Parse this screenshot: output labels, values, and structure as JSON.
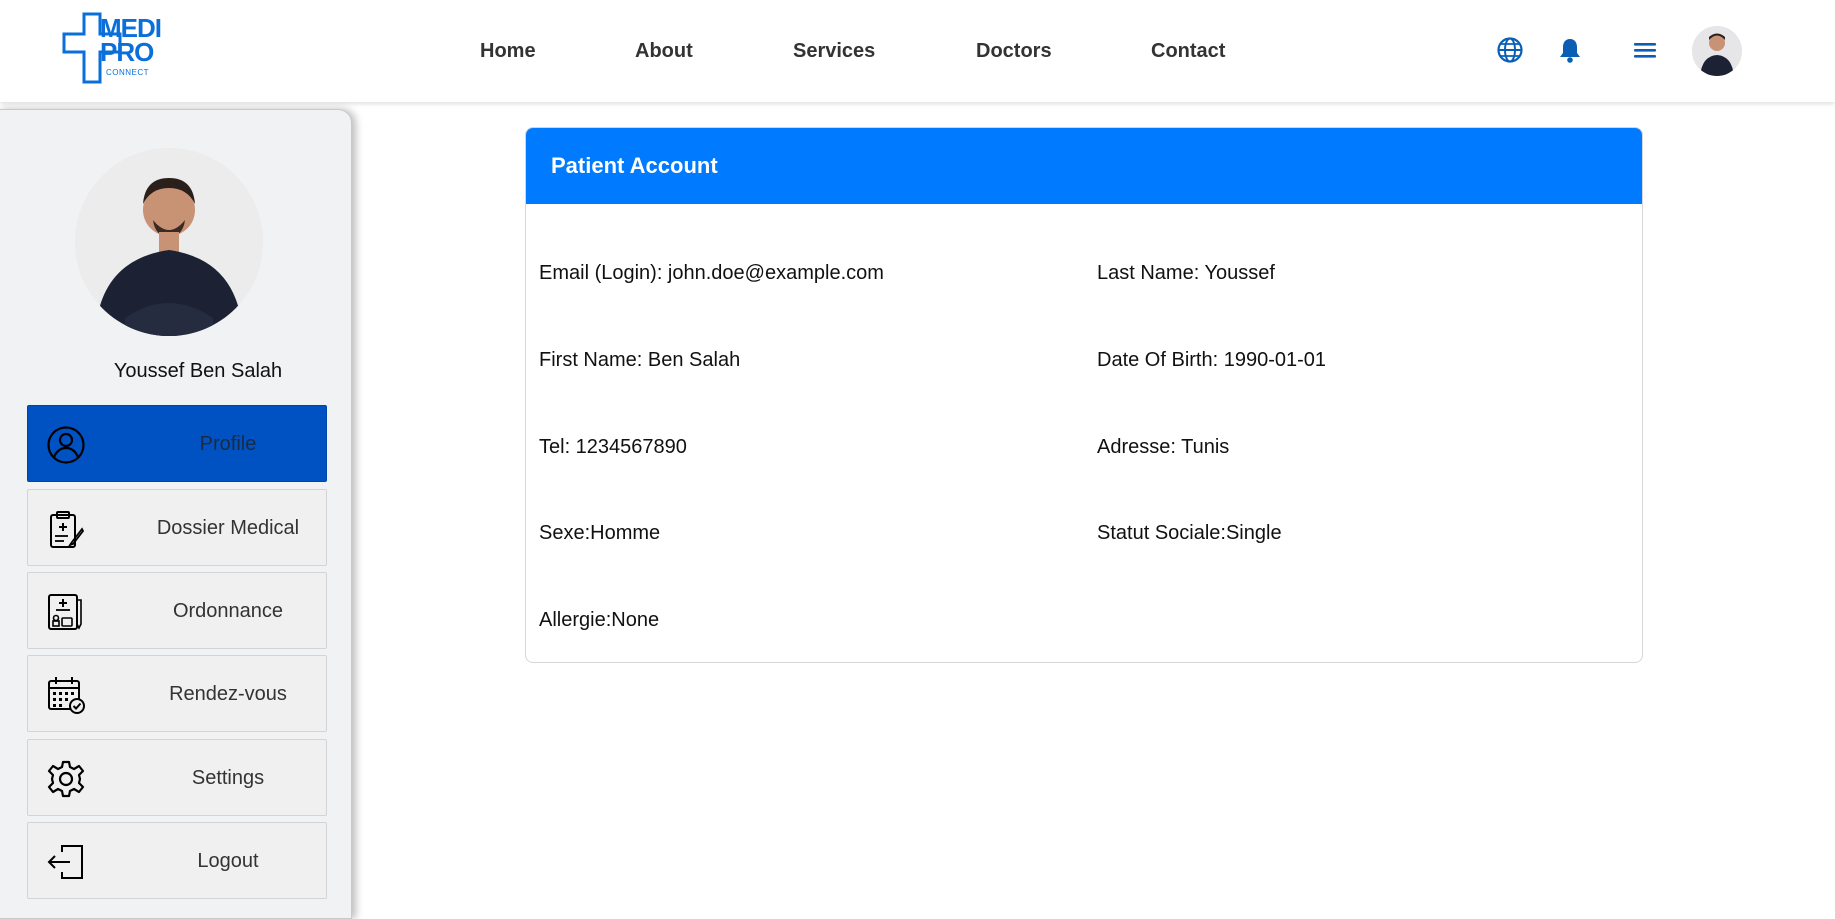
{
  "logo": {
    "line1": "MEDI",
    "line2": "PRO",
    "sub": "CONNECT",
    "brand_color": "#0a6fd8"
  },
  "nav": {
    "home": "Home",
    "about": "About",
    "services": "Services",
    "doctors": "Doctors",
    "contact": "Contact"
  },
  "header_icons": [
    "globe-icon",
    "bell-icon",
    "menu-icon"
  ],
  "sidebar": {
    "user_name": "Youssef Ben Salah",
    "items": [
      {
        "label": "Profile",
        "icon": "user-circle-icon",
        "active": true
      },
      {
        "label": "Dossier Medical",
        "icon": "medical-clipboard-icon"
      },
      {
        "label": "Ordonnance",
        "icon": "prescription-icon"
      },
      {
        "label": "Rendez-vous",
        "icon": "calendar-check-icon"
      },
      {
        "label": "Settings",
        "icon": "gear-icon"
      },
      {
        "label": "Logout",
        "icon": "logout-icon"
      }
    ]
  },
  "card": {
    "title": "Patient Account",
    "fields": {
      "email": "Email (Login): john.doe@example.com",
      "last_name": "Last Name: Youssef",
      "first_name": "First Name: Ben Salah",
      "dob": "Date Of Birth: 1990-01-01",
      "tel": "Tel: 1234567890",
      "adresse": "Adresse: Tunis",
      "sexe": "Sexe:Homme",
      "statut": "Statut Sociale:Single",
      "allergie": "Allergie:None"
    }
  },
  "colors": {
    "header_blue": "#007bff",
    "active_blue": "#0052c2",
    "icon_blue": "#0a5fb5"
  }
}
